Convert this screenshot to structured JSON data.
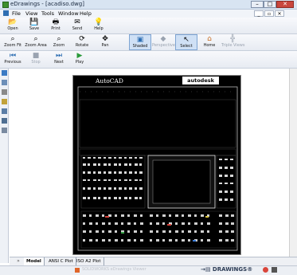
{
  "window": {
    "title": "eDrawings - [acadiso.dwg]",
    "minimize": "–",
    "maximize": "□",
    "close": "✕"
  },
  "menu": {
    "items": [
      "File",
      "View",
      "Tools",
      "Window",
      "Help"
    ],
    "mdi_min": "_",
    "mdi_max": "▫",
    "mdi_close": "✕"
  },
  "toolbar1": [
    {
      "label": "Open",
      "icon": "open-folder-icon",
      "glyph": "📂"
    },
    {
      "label": "Save",
      "icon": "save-icon",
      "glyph": "💾"
    },
    {
      "label": "Print",
      "icon": "print-icon",
      "glyph": "🖶"
    },
    {
      "label": "Send",
      "icon": "send-icon",
      "glyph": "✉"
    },
    {
      "label": "Help",
      "icon": "help-icon",
      "glyph": "💡"
    }
  ],
  "toolbar2": [
    {
      "label": "Zoom Fit",
      "icon": "zoom-fit-icon",
      "glyph": "⌕",
      "state": "normal"
    },
    {
      "label": "Zoom Area",
      "icon": "zoom-area-icon",
      "glyph": "⌕",
      "state": "normal"
    },
    {
      "label": "Zoom",
      "icon": "zoom-icon",
      "glyph": "⌕",
      "state": "normal"
    },
    {
      "label": "Rotate",
      "icon": "rotate-icon",
      "glyph": "⟳",
      "state": "normal"
    },
    {
      "label": "Pan",
      "icon": "pan-icon",
      "glyph": "✥",
      "state": "normal"
    },
    {
      "label": "Shaded",
      "icon": "shaded-icon",
      "glyph": "▣",
      "state": "active"
    },
    {
      "label": "Perspective",
      "icon": "perspective-icon",
      "glyph": "◆",
      "state": "disabled"
    },
    {
      "label": "Select",
      "icon": "select-cursor-icon",
      "glyph": "↖",
      "state": "active"
    },
    {
      "label": "Home",
      "icon": "home-icon",
      "glyph": "⌂",
      "state": "normal"
    },
    {
      "label": "Triple Views",
      "icon": "triple-views-icon",
      "glyph": "╬",
      "state": "disabled"
    }
  ],
  "toolbar3": [
    {
      "label": "Previous",
      "icon": "previous-icon",
      "glyph": "⏮",
      "state": "normal"
    },
    {
      "label": "Stop",
      "icon": "stop-icon",
      "glyph": "■",
      "state": "disabled"
    },
    {
      "label": "Next",
      "icon": "next-icon",
      "glyph": "⏭",
      "state": "normal"
    },
    {
      "label": "Play",
      "icon": "play-icon",
      "glyph": "▶",
      "state": "normal"
    }
  ],
  "drawing": {
    "autocad_label": "AutoCAD",
    "autodesk_label": "autodesk"
  },
  "tabs": {
    "expand": "»",
    "items": [
      "Model",
      "ANSI C Plot",
      "ISO A2 Plot"
    ]
  },
  "status": {
    "text": "SOLIDWORKS eDrawings Viewer",
    "brand": "→▤ DRAWINGS®"
  },
  "colors": {
    "accent": "#2f6fb3",
    "drawing_bg": "#000000",
    "status_warn": "#e0662a"
  }
}
